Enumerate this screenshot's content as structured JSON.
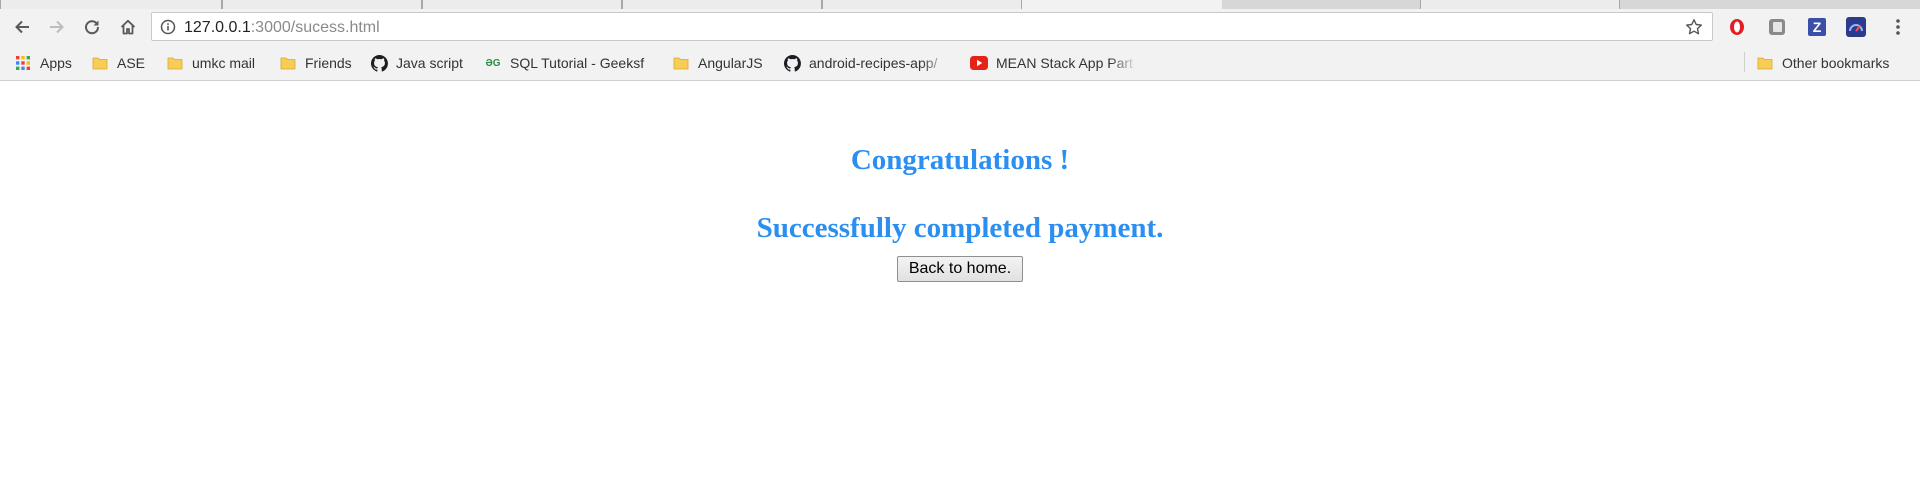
{
  "browser": {
    "url_host": "127.0.0.1",
    "url_rest": ":3000/sucess.html",
    "icons": {
      "back": "back-arrow-icon",
      "forward": "forward-arrow-icon",
      "reload": "reload-icon",
      "home": "home-icon",
      "info": "info-icon",
      "star": "star-icon",
      "menu": "kebab-menu-icon"
    },
    "extensions": [
      {
        "name": "opera-extension-icon",
        "color": "#e21d25"
      },
      {
        "name": "grey-extension-icon",
        "color": "#8a8a8a"
      },
      {
        "name": "z-extension-icon",
        "color": "#3c4fa8",
        "letter": "Z"
      },
      {
        "name": "speedometer-extension-icon",
        "color": "#2b3a8a"
      }
    ]
  },
  "bookmarks": {
    "items": [
      {
        "label": "Apps",
        "icon": "apps-grid-icon"
      },
      {
        "label": "ASE",
        "icon": "folder-icon"
      },
      {
        "label": "umkc mail",
        "icon": "folder-icon"
      },
      {
        "label": "Friends",
        "icon": "folder-icon"
      },
      {
        "label": "Java script",
        "icon": "github-icon"
      },
      {
        "label": "SQL Tutorial - Geeksf",
        "icon": "geeksforgeeks-icon",
        "icon_text": "ƏG"
      },
      {
        "label": "AngularJS",
        "icon": "folder-icon"
      },
      {
        "label": "android-recipes-app/",
        "icon": "github-icon"
      },
      {
        "label": "MEAN Stack App Part",
        "icon": "youtube-icon"
      }
    ],
    "other": {
      "label": "Other bookmarks",
      "icon": "folder-icon"
    }
  },
  "page": {
    "heading": "Congratulations !",
    "subheading": "Successfully completed payment.",
    "button_label": "Back to home."
  },
  "colors": {
    "heading": "#2b8ff2",
    "folder": "#f7cd57",
    "youtube": "#e62117",
    "geeks": "#2f8d46"
  }
}
